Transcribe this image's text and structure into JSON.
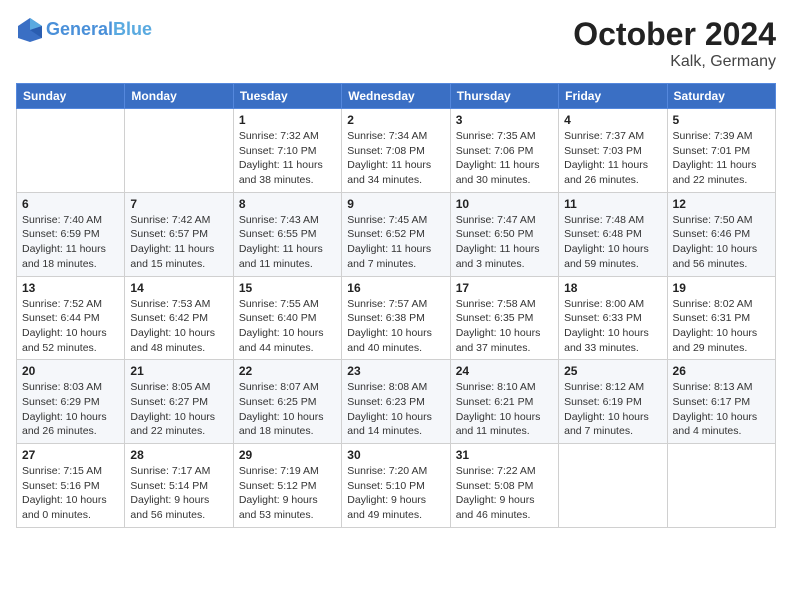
{
  "header": {
    "logo_line1": "General",
    "logo_line2": "Blue",
    "month": "October 2024",
    "location": "Kalk, Germany"
  },
  "weekdays": [
    "Sunday",
    "Monday",
    "Tuesday",
    "Wednesday",
    "Thursday",
    "Friday",
    "Saturday"
  ],
  "weeks": [
    [
      {
        "day": "",
        "info": ""
      },
      {
        "day": "",
        "info": ""
      },
      {
        "day": "1",
        "info": "Sunrise: 7:32 AM\nSunset: 7:10 PM\nDaylight: 11 hours and 38 minutes."
      },
      {
        "day": "2",
        "info": "Sunrise: 7:34 AM\nSunset: 7:08 PM\nDaylight: 11 hours and 34 minutes."
      },
      {
        "day": "3",
        "info": "Sunrise: 7:35 AM\nSunset: 7:06 PM\nDaylight: 11 hours and 30 minutes."
      },
      {
        "day": "4",
        "info": "Sunrise: 7:37 AM\nSunset: 7:03 PM\nDaylight: 11 hours and 26 minutes."
      },
      {
        "day": "5",
        "info": "Sunrise: 7:39 AM\nSunset: 7:01 PM\nDaylight: 11 hours and 22 minutes."
      }
    ],
    [
      {
        "day": "6",
        "info": "Sunrise: 7:40 AM\nSunset: 6:59 PM\nDaylight: 11 hours and 18 minutes."
      },
      {
        "day": "7",
        "info": "Sunrise: 7:42 AM\nSunset: 6:57 PM\nDaylight: 11 hours and 15 minutes."
      },
      {
        "day": "8",
        "info": "Sunrise: 7:43 AM\nSunset: 6:55 PM\nDaylight: 11 hours and 11 minutes."
      },
      {
        "day": "9",
        "info": "Sunrise: 7:45 AM\nSunset: 6:52 PM\nDaylight: 11 hours and 7 minutes."
      },
      {
        "day": "10",
        "info": "Sunrise: 7:47 AM\nSunset: 6:50 PM\nDaylight: 11 hours and 3 minutes."
      },
      {
        "day": "11",
        "info": "Sunrise: 7:48 AM\nSunset: 6:48 PM\nDaylight: 10 hours and 59 minutes."
      },
      {
        "day": "12",
        "info": "Sunrise: 7:50 AM\nSunset: 6:46 PM\nDaylight: 10 hours and 56 minutes."
      }
    ],
    [
      {
        "day": "13",
        "info": "Sunrise: 7:52 AM\nSunset: 6:44 PM\nDaylight: 10 hours and 52 minutes."
      },
      {
        "day": "14",
        "info": "Sunrise: 7:53 AM\nSunset: 6:42 PM\nDaylight: 10 hours and 48 minutes."
      },
      {
        "day": "15",
        "info": "Sunrise: 7:55 AM\nSunset: 6:40 PM\nDaylight: 10 hours and 44 minutes."
      },
      {
        "day": "16",
        "info": "Sunrise: 7:57 AM\nSunset: 6:38 PM\nDaylight: 10 hours and 40 minutes."
      },
      {
        "day": "17",
        "info": "Sunrise: 7:58 AM\nSunset: 6:35 PM\nDaylight: 10 hours and 37 minutes."
      },
      {
        "day": "18",
        "info": "Sunrise: 8:00 AM\nSunset: 6:33 PM\nDaylight: 10 hours and 33 minutes."
      },
      {
        "day": "19",
        "info": "Sunrise: 8:02 AM\nSunset: 6:31 PM\nDaylight: 10 hours and 29 minutes."
      }
    ],
    [
      {
        "day": "20",
        "info": "Sunrise: 8:03 AM\nSunset: 6:29 PM\nDaylight: 10 hours and 26 minutes."
      },
      {
        "day": "21",
        "info": "Sunrise: 8:05 AM\nSunset: 6:27 PM\nDaylight: 10 hours and 22 minutes."
      },
      {
        "day": "22",
        "info": "Sunrise: 8:07 AM\nSunset: 6:25 PM\nDaylight: 10 hours and 18 minutes."
      },
      {
        "day": "23",
        "info": "Sunrise: 8:08 AM\nSunset: 6:23 PM\nDaylight: 10 hours and 14 minutes."
      },
      {
        "day": "24",
        "info": "Sunrise: 8:10 AM\nSunset: 6:21 PM\nDaylight: 10 hours and 11 minutes."
      },
      {
        "day": "25",
        "info": "Sunrise: 8:12 AM\nSunset: 6:19 PM\nDaylight: 10 hours and 7 minutes."
      },
      {
        "day": "26",
        "info": "Sunrise: 8:13 AM\nSunset: 6:17 PM\nDaylight: 10 hours and 4 minutes."
      }
    ],
    [
      {
        "day": "27",
        "info": "Sunrise: 7:15 AM\nSunset: 5:16 PM\nDaylight: 10 hours and 0 minutes."
      },
      {
        "day": "28",
        "info": "Sunrise: 7:17 AM\nSunset: 5:14 PM\nDaylight: 9 hours and 56 minutes."
      },
      {
        "day": "29",
        "info": "Sunrise: 7:19 AM\nSunset: 5:12 PM\nDaylight: 9 hours and 53 minutes."
      },
      {
        "day": "30",
        "info": "Sunrise: 7:20 AM\nSunset: 5:10 PM\nDaylight: 9 hours and 49 minutes."
      },
      {
        "day": "31",
        "info": "Sunrise: 7:22 AM\nSunset: 5:08 PM\nDaylight: 9 hours and 46 minutes."
      },
      {
        "day": "",
        "info": ""
      },
      {
        "day": "",
        "info": ""
      }
    ]
  ]
}
